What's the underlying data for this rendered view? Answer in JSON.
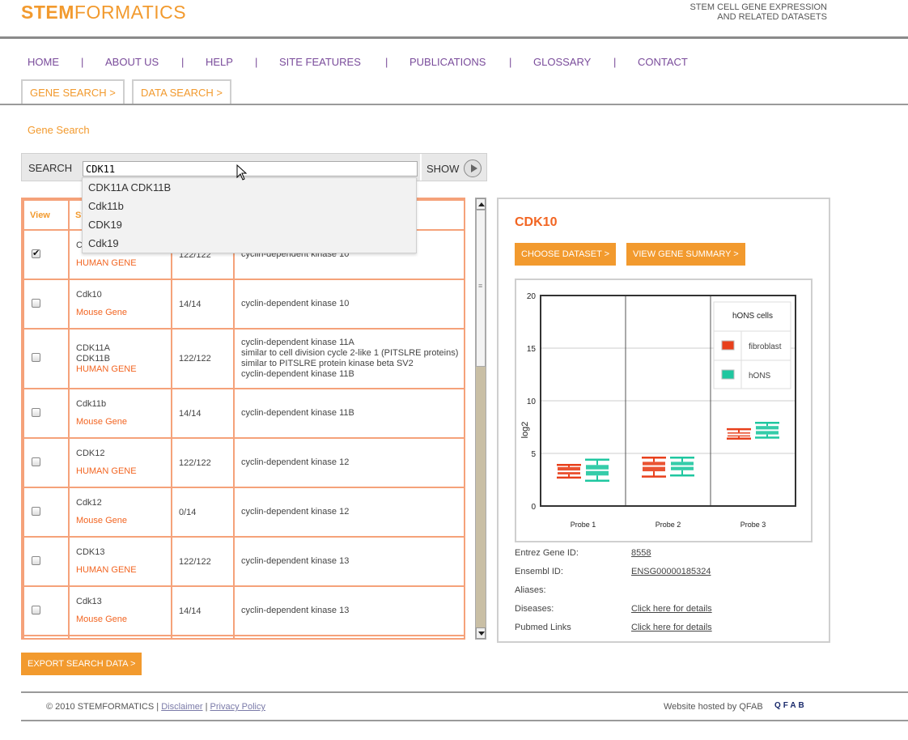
{
  "header": {
    "logo_bold": "STEM",
    "logo_rest": "FORMATICS",
    "tagline_line1": "STEM CELL GENE EXPRESSION",
    "tagline_line2": "AND RELATED DATASETS"
  },
  "nav": {
    "items": [
      "HOME",
      "ABOUT US",
      "HELP",
      "SITE FEATURES",
      "PUBLICATIONS",
      "GLOSSARY",
      "CONTACT"
    ],
    "separator": "|"
  },
  "tabs": [
    "GENE SEARCH >",
    "DATA SEARCH >"
  ],
  "breadcrumb": "Gene Search",
  "search": {
    "label": "SEARCH",
    "value": "CDK11",
    "show_label": "SHOW",
    "suggestions": [
      "CDK11A CDK11B",
      "Cdk11b",
      "CDK19",
      "Cdk19"
    ]
  },
  "results": {
    "headers": [
      "View",
      "Sy"
    ],
    "rows": [
      {
        "checked": true,
        "symbol": "C",
        "species": "HUMAN GENE",
        "count": "122/122",
        "description": "cyclin-dependent kinase 10"
      },
      {
        "checked": false,
        "symbol": "Cdk10",
        "species": "Mouse Gene",
        "count": "14/14",
        "description": "cyclin-dependent kinase 10"
      },
      {
        "checked": false,
        "symbol": "CDK11A\nCDK11B",
        "species": "HUMAN GENE",
        "count": "122/122",
        "description": "cyclin-dependent kinase 11A\nsimilar to cell division cycle 2-like 1 (PITSLRE proteins)\nsimilar to PITSLRE protein kinase beta SV2\ncyclin-dependent kinase 11B"
      },
      {
        "checked": false,
        "symbol": "Cdk11b",
        "species": "Mouse Gene",
        "count": "14/14",
        "description": "cyclin-dependent kinase 11B"
      },
      {
        "checked": false,
        "symbol": "CDK12",
        "species": "HUMAN GENE",
        "count": "122/122",
        "description": "cyclin-dependent kinase 12"
      },
      {
        "checked": false,
        "symbol": "Cdk12",
        "species": "Mouse Gene",
        "count": "0/14",
        "description": "cyclin-dependent kinase 12"
      },
      {
        "checked": false,
        "symbol": "CDK13",
        "species": "HUMAN GENE",
        "count": "122/122",
        "description": "cyclin-dependent kinase 13"
      },
      {
        "checked": false,
        "symbol": "Cdk13",
        "species": "Mouse Gene",
        "count": "14/14",
        "description": "cyclin-dependent kinase 13"
      }
    ]
  },
  "detail": {
    "gene": "CDK10",
    "choose_dataset": "CHOOSE DATASET >",
    "view_summary": "VIEW GENE SUMMARY >",
    "info": [
      {
        "label": "Entrez Gene ID:",
        "value": "8558"
      },
      {
        "label": "Ensembl ID:",
        "value": "ENSG00000185324"
      },
      {
        "label": "Aliases:",
        "value": ""
      },
      {
        "label": "Diseases:",
        "value": "Click here for details"
      },
      {
        "label": "Pubmed Links",
        "value": "Click here for details"
      }
    ]
  },
  "chart_data": {
    "type": "box",
    "categories": [
      "Probe 1",
      "Probe 2",
      "Probe 3"
    ],
    "ylabel": "log2",
    "ylim": [
      0,
      20
    ],
    "yticks": [
      0,
      5,
      10,
      15,
      20
    ],
    "legend_title": "hONS cells",
    "legend_position": "top-right",
    "grid": true,
    "series": [
      {
        "name": "fibroblast",
        "color": "#e8401c",
        "boxes": [
          {
            "min": 2.7,
            "q1": 3.0,
            "median": 3.3,
            "q3": 3.7,
            "max": 3.9
          },
          {
            "min": 2.8,
            "q1": 3.3,
            "median": 3.8,
            "q3": 4.2,
            "max": 4.6
          },
          {
            "min": 6.4,
            "q1": 6.6,
            "median": 6.8,
            "q3": 7.0,
            "max": 7.3
          }
        ]
      },
      {
        "name": "hONS",
        "color": "#1fc7a0",
        "boxes": [
          {
            "min": 2.4,
            "q1": 2.9,
            "median": 3.4,
            "q3": 3.9,
            "max": 4.4
          },
          {
            "min": 2.9,
            "q1": 3.4,
            "median": 3.8,
            "q3": 4.2,
            "max": 4.6
          },
          {
            "min": 6.5,
            "q1": 6.8,
            "median": 7.2,
            "q3": 7.6,
            "max": 7.9
          }
        ]
      }
    ]
  },
  "export_label": "EXPORT SEARCH DATA >",
  "footer": {
    "copyright": "© 2010 STEMFORMATICS |",
    "disclaimer": "Disclaimer",
    "sep": "|",
    "privacy": "Privacy Policy",
    "hosted": "Website hosted by QFAB",
    "qfab": "QFAB"
  }
}
